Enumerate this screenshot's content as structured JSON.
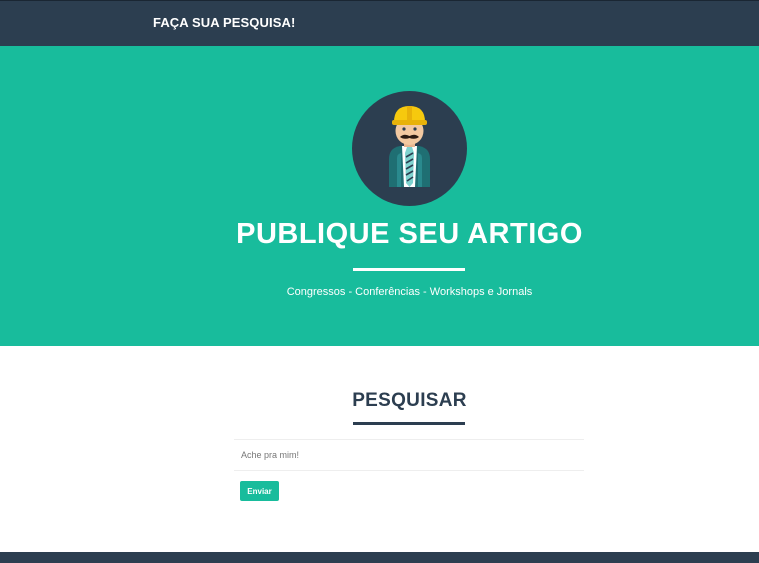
{
  "navbar": {
    "brand": "FAÇA SUA PESQUISA!"
  },
  "hero": {
    "avatar_icon": "construction-worker-icon",
    "title": "PUBLIQUE SEU ARTIGO",
    "subtitle": "Congressos - Conferências - Workshops e Jornals"
  },
  "search": {
    "title": "PESQUISAR",
    "placeholder": "Ache pra mim!",
    "value": "",
    "submit_label": "Enviar"
  },
  "colors": {
    "navy": "#2c3e50",
    "teal": "#18bc9c",
    "white": "#ffffff"
  }
}
